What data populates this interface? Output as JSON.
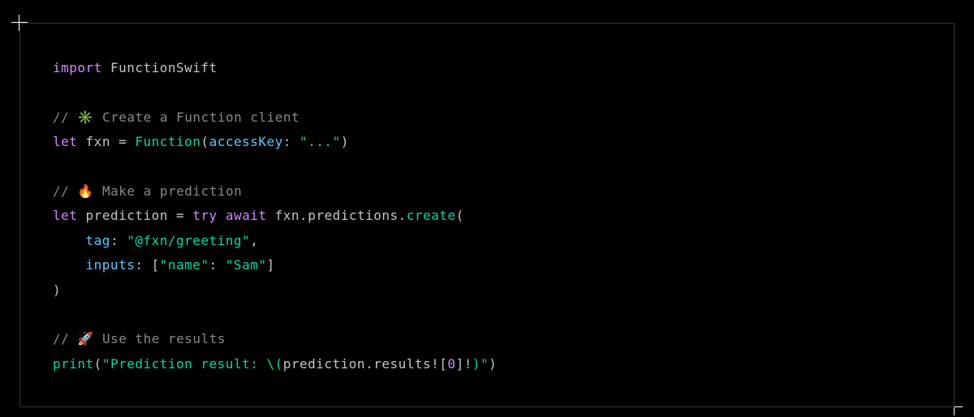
{
  "code": {
    "line1": {
      "import_kw": "import",
      "module": "FunctionSwift"
    },
    "line2": "",
    "line3": {
      "comment_prefix": "// ",
      "emoji": "✳️",
      "comment_text": " Create a Function client"
    },
    "line4": {
      "let_kw": "let",
      "var": "fxn",
      "eq": " = ",
      "func": "Function",
      "open": "(",
      "label": "accessKey",
      "colon": ": ",
      "string": "\"...\"",
      "close": ")"
    },
    "line5": "",
    "line6": {
      "comment_prefix": "// ",
      "emoji": "🔥",
      "comment_text": " Make a prediction"
    },
    "line7": {
      "let_kw": "let",
      "var": "prediction",
      "eq": " = ",
      "try_kw": "try",
      "await_kw": "await",
      "obj1": "fxn",
      "dot1": ".",
      "obj2": "predictions",
      "dot2": ".",
      "method": "create",
      "open": "("
    },
    "line8": {
      "indent": "    ",
      "label": "tag",
      "colon": ": ",
      "string": "\"@fxn/greeting\"",
      "comma": ","
    },
    "line9": {
      "indent": "    ",
      "label": "inputs",
      "colon": ": ",
      "open": "[",
      "key": "\"name\"",
      "kcolon": ": ",
      "val": "\"Sam\"",
      "close": "]"
    },
    "line10": {
      "close": ")"
    },
    "line11": "",
    "line12": {
      "comment_prefix": "// ",
      "emoji": "🚀",
      "comment_text": " Use the results"
    },
    "line13": {
      "func": "print",
      "open": "(",
      "str1": "\"Prediction result: ",
      "interp_open": "\\(",
      "obj": "prediction",
      "dot": ".",
      "prop": "results",
      "bang1": "!",
      "bracket_open": "[",
      "idx": "0",
      "bracket_close": "]",
      "bang2": "!",
      "interp_close": ")",
      "str2": "\"",
      "close": ")"
    }
  }
}
